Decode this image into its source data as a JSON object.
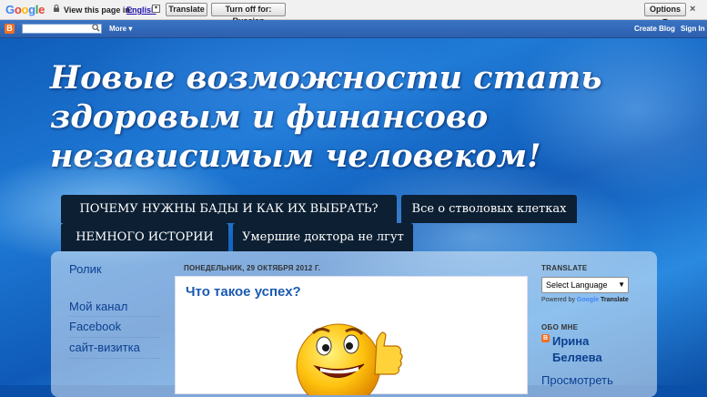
{
  "translate_bar": {
    "logo": "Google",
    "view_text": "View this page in:",
    "language": "English",
    "translate_btn": "Translate",
    "turn_off_btn": "Turn off for: Russian",
    "options_btn": "Options ▼",
    "close": "×"
  },
  "navbar": {
    "more": "More ▾",
    "create_blog": "Create Blog",
    "sign_in": "Sign In"
  },
  "header": {
    "title": "Новые возможности стать здоровым и финансово независимым человеком!"
  },
  "tabs": [
    {
      "label": "ПОЧЕМУ НУЖНЫ БАДЫ И КАК ИХ ВЫБРАТЬ?"
    },
    {
      "label": "Все о стволовых клетках"
    },
    {
      "label": "НЕМНОГО ИСТОРИИ"
    },
    {
      "label": "Умершие доктора не лгут"
    }
  ],
  "sidebar_left": {
    "links": [
      {
        "label": "Ролик"
      },
      {
        "label": "Мой канал"
      },
      {
        "label": "Facebook"
      },
      {
        "label": "сайт-визитка"
      }
    ]
  },
  "post": {
    "date": "ПОНЕДЕЛЬНИК, 29 ОКТЯБРЯ 2012 Г.",
    "title": "Что такое успех?"
  },
  "sidebar_right": {
    "translate_heading": "TRANSLATE",
    "select_language": "Select Language",
    "powered_by": "Powered by",
    "powered_google": "Google",
    "powered_translate": "Translate",
    "about_heading": "ОБО МНЕ",
    "profile_first": "Ирина",
    "profile_last": "Беляева",
    "view_link": "Просмотреть"
  },
  "colors": {
    "link": "#0c3f8f",
    "post_title": "#1b5bb1",
    "tab_bg": "#0c1f33",
    "blogger_orange": "#f37020"
  }
}
